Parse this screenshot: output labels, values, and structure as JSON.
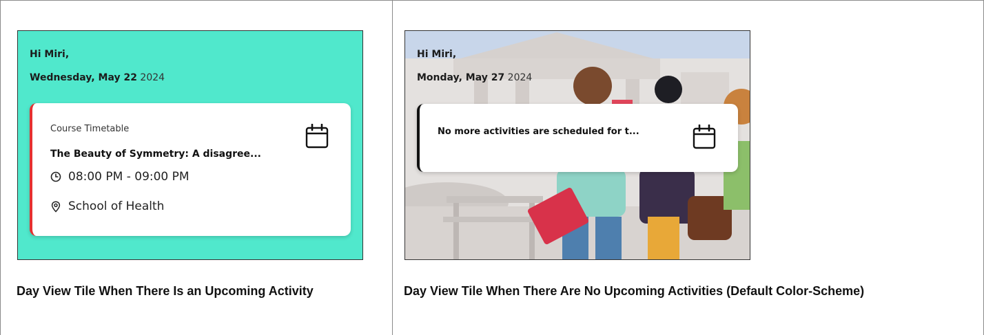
{
  "left_tile": {
    "greeting": "Hi Miri,",
    "date_main": "Wednesday, May 22",
    "date_year": "2024",
    "card": {
      "kind": "Course Timetable",
      "title": "The Beauty of Symmetry: A disagree...",
      "time": "08:00 PM - 09:00 PM",
      "location": "School of Health",
      "accent_color": "#e53030"
    },
    "background_color": "#50e8cc",
    "caption": "Day View Tile When There Is an Upcoming Activity"
  },
  "right_tile": {
    "greeting": "Hi Miri,",
    "date_main": "Monday, May 27",
    "date_year": "2024",
    "card": {
      "message": "No more activities are scheduled for t...",
      "accent_color": "#111111"
    },
    "caption": "Day View Tile When There Are No Upcoming Activities (Default Color-Scheme)"
  },
  "icons": {
    "calendar": "calendar-icon",
    "clock": "clock-icon",
    "location": "location-pin-icon"
  }
}
